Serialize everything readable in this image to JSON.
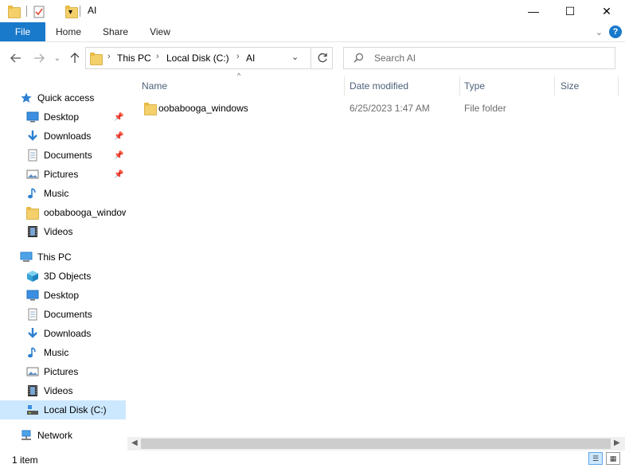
{
  "window": {
    "title": "AI",
    "controls": {
      "minimize": "—",
      "maximize": "☐",
      "close": "✕"
    }
  },
  "ribbon": {
    "tabs": [
      {
        "label": "File"
      },
      {
        "label": "Home"
      },
      {
        "label": "Share"
      },
      {
        "label": "View"
      }
    ]
  },
  "address": {
    "crumbs": [
      "This PC",
      "Local Disk (C:)",
      "AI"
    ]
  },
  "search": {
    "placeholder": "Search AI"
  },
  "nav": {
    "quick_access": "Quick access",
    "quick_items": [
      "Desktop",
      "Downloads",
      "Documents",
      "Pictures",
      "Music",
      "oobabooga_windows",
      "Videos"
    ],
    "this_pc": "This PC",
    "pc_items": [
      "3D Objects",
      "Desktop",
      "Documents",
      "Downloads",
      "Music",
      "Pictures",
      "Videos",
      "Local Disk (C:)"
    ],
    "network": "Network"
  },
  "columns": {
    "name": "Name",
    "date": "Date modified",
    "type": "Type",
    "size": "Size"
  },
  "files": [
    {
      "name": "oobabooga_windows",
      "date": "6/25/2023 1:47 AM",
      "type": "File folder",
      "size": ""
    }
  ],
  "status": {
    "count": "1 item"
  },
  "colors": {
    "accent": "#1979ca",
    "selection": "#cce8ff",
    "folder": "#f4d06b"
  }
}
